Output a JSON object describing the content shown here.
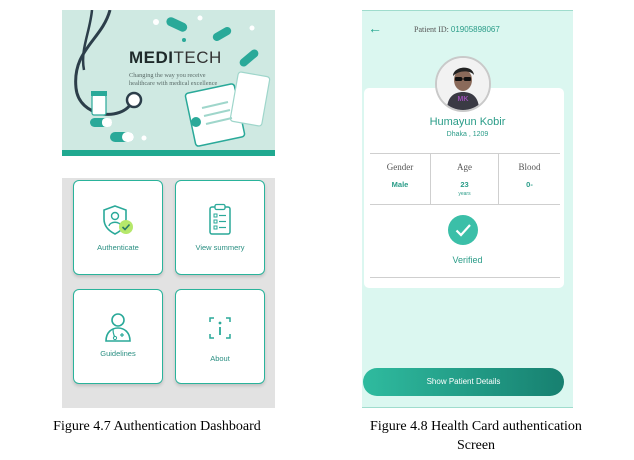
{
  "dashboard": {
    "brand_bold": "MEDI",
    "brand_light": "TECH",
    "tagline": "Changing the way you receive healthcare with medical excellence",
    "tiles": [
      {
        "label": "Authenticate",
        "icon": "shield-user-icon"
      },
      {
        "label": "View summery",
        "icon": "clipboard-list-icon"
      },
      {
        "label": "Guidelines",
        "icon": "doctor-icon"
      },
      {
        "label": "About",
        "icon": "info-icon"
      }
    ],
    "caption": "Figure 4.7 Authentication Dashboard"
  },
  "health_card": {
    "back_icon": "back-arrow-icon",
    "pid_label": "Patient ID:",
    "pid_value": "01905898067",
    "avatar_initials": "MK",
    "name": "Humayun Kobir",
    "address": "Dhaka , 1209",
    "stats": [
      {
        "label": "Gender",
        "value": "Male",
        "unit": ""
      },
      {
        "label": "Age",
        "value": "23",
        "unit": "years"
      },
      {
        "label": "Blood",
        "value": "0-",
        "unit": ""
      }
    ],
    "status_icon": "check-circle-icon",
    "status": "Verified",
    "button_label": "Show Patient Details",
    "caption_line1": "Figure 4.8 Health Card authentication",
    "caption_line2": "Screen"
  },
  "colors": {
    "accent": "#20a990",
    "header_bg": "#cfe9e2",
    "card_bg": "#dbf7f0"
  }
}
